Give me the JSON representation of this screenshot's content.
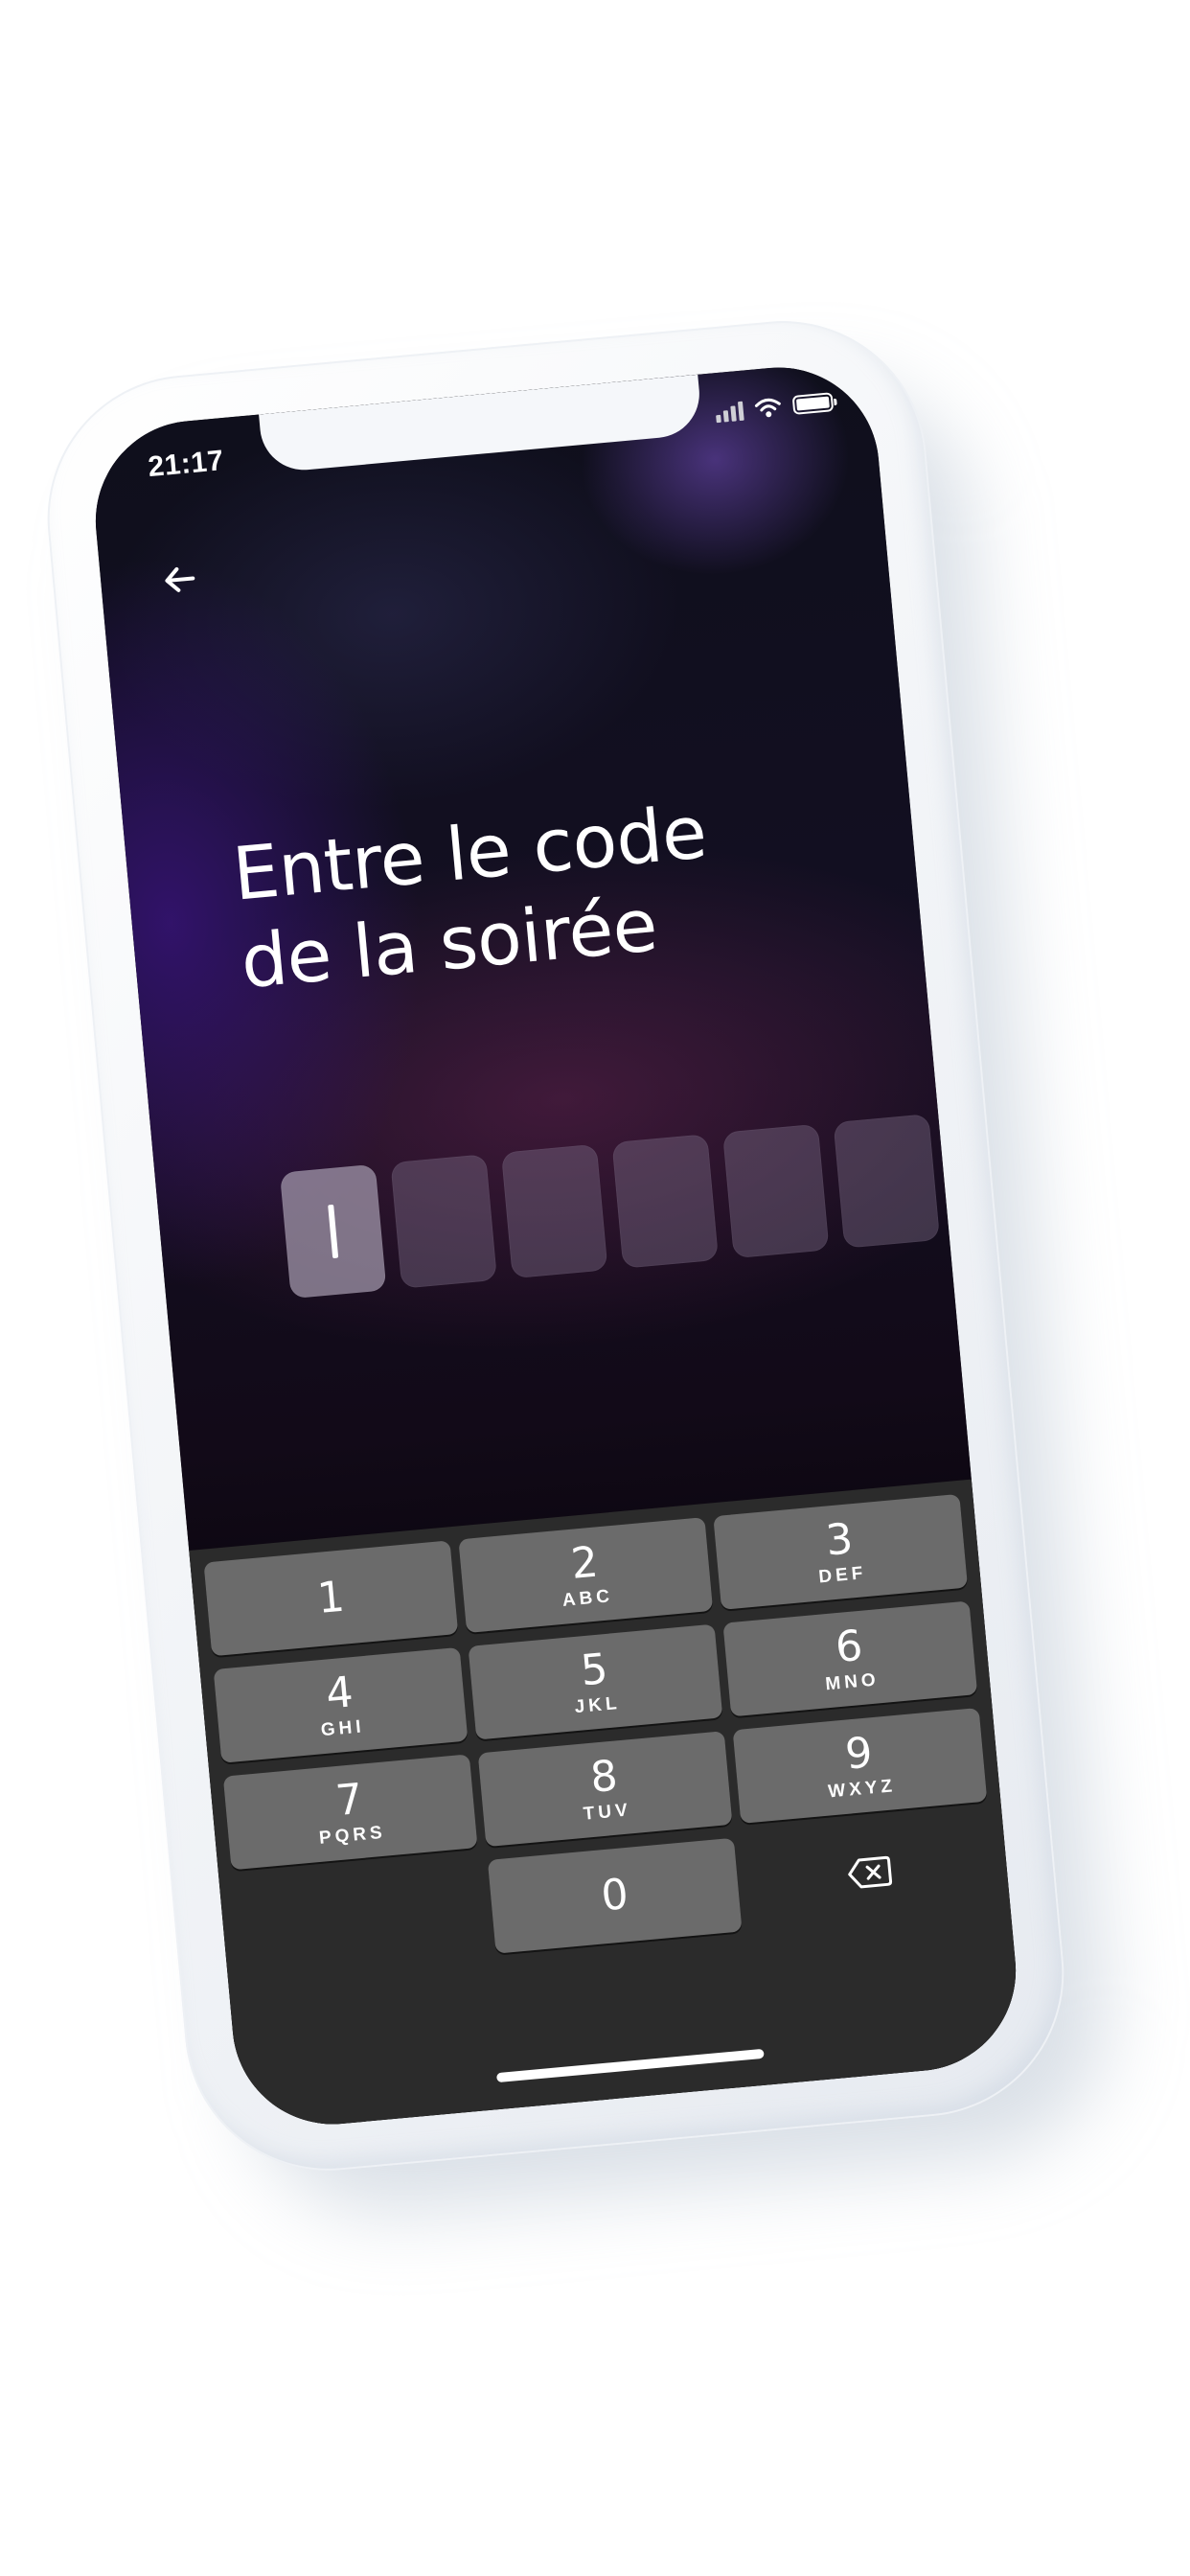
{
  "status_bar": {
    "time": "21:17",
    "icons": [
      "cellular-signal-icon",
      "wifi-icon",
      "battery-icon"
    ]
  },
  "header": {
    "back_icon": "arrow-left-icon"
  },
  "title": {
    "line1": "Entre le code",
    "line2": "de la soirée"
  },
  "code_input": {
    "length": 6,
    "entered": "",
    "active_index": 0
  },
  "keypad": {
    "keys": [
      {
        "digit": "1",
        "letters": ""
      },
      {
        "digit": "2",
        "letters": "ABC"
      },
      {
        "digit": "3",
        "letters": "DEF"
      },
      {
        "digit": "4",
        "letters": "GHI"
      },
      {
        "digit": "5",
        "letters": "JKL"
      },
      {
        "digit": "6",
        "letters": "MNO"
      },
      {
        "digit": "7",
        "letters": "PQRS"
      },
      {
        "digit": "8",
        "letters": "TUV"
      },
      {
        "digit": "9",
        "letters": "WXYZ"
      },
      {
        "digit": "0",
        "letters": ""
      }
    ],
    "delete_icon": "backspace-icon"
  },
  "colors": {
    "keyboard_background": "#2b2b2b",
    "key_background": "#6b6b6b",
    "code_box": "#786982",
    "code_box_active": "#a096aa",
    "text": "#ffffff"
  }
}
